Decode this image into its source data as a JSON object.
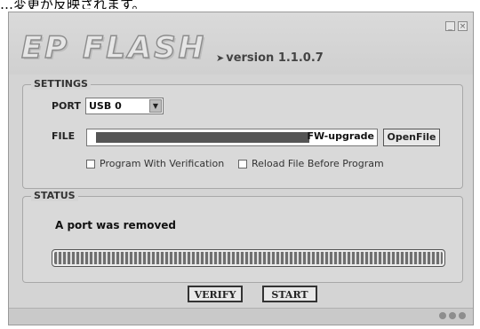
{
  "caption": "…変更が反映されます。",
  "window": {
    "logo": "EP FLASH",
    "version": "version 1.1.0.7",
    "version_arrow": "➤",
    "minimize_glyph": "_",
    "close_glyph": "×"
  },
  "settings": {
    "group_label": "SETTINGS",
    "port_label": "PORT",
    "port_value": "USB 0",
    "port_dropdown_glyph": "▼",
    "file_label": "FILE",
    "file_visible_text": "FW-upgrade",
    "openfile_label": "OpenFile",
    "program_with_verification": "Program With Verification",
    "reload_before_program": "Reload File Before Program"
  },
  "status": {
    "group_label": "STATUS",
    "message": "A port was removed",
    "progress": 1.0
  },
  "actions": {
    "verify_label": "VERIFY",
    "start_label": "START"
  },
  "icons": [
    "minimize-icon",
    "close-icon",
    "dropdown-arrow-icon",
    "status-dots-icon"
  ]
}
